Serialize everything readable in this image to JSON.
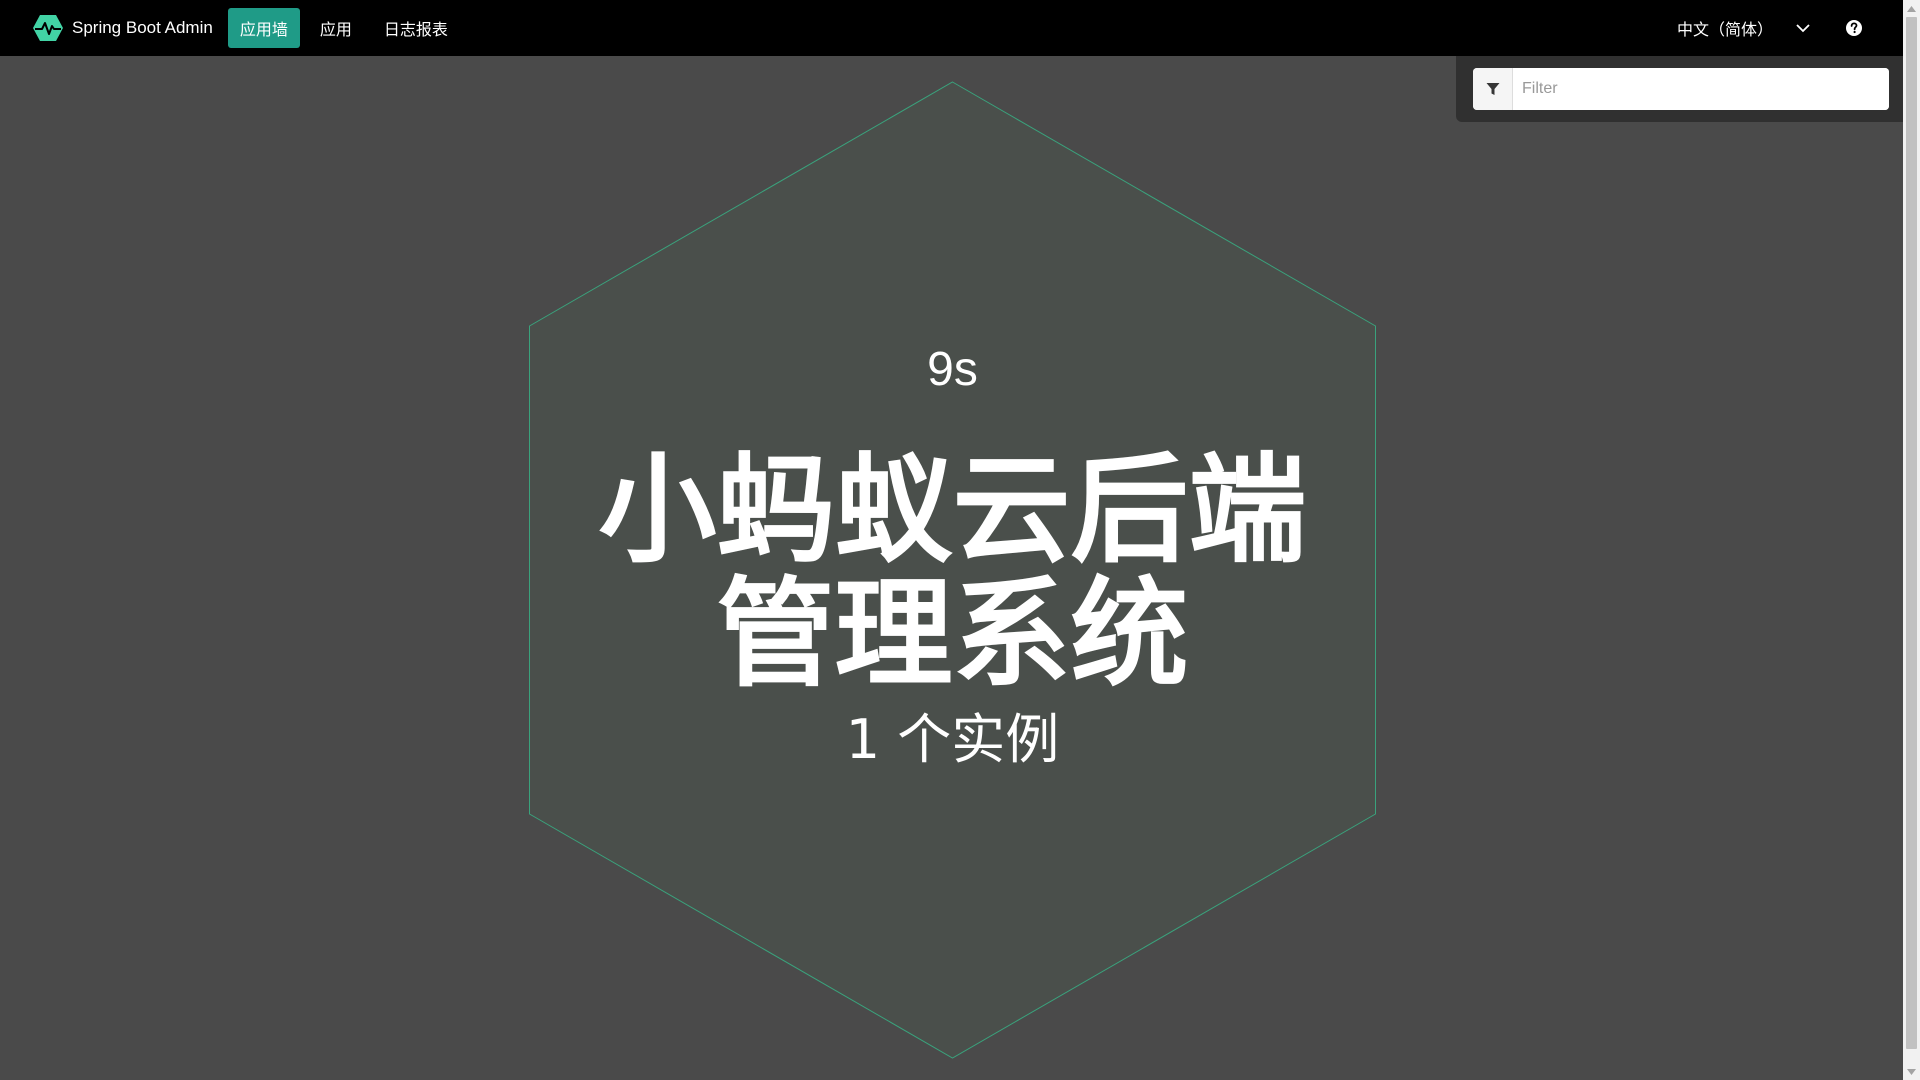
{
  "navbar": {
    "brand": "Spring Boot Admin",
    "items": [
      {
        "label": "应用墙",
        "active": true
      },
      {
        "label": "应用",
        "active": false
      },
      {
        "label": "日志报表",
        "active": false
      }
    ],
    "language": "中文（简体）",
    "icons": {
      "logo": "heartbeat-hexagon-logo",
      "language_toggle": "chevron-down-icon",
      "help": "question-circle-icon"
    }
  },
  "filter": {
    "placeholder": "Filter",
    "value": "",
    "icon": "filter-icon"
  },
  "applications": [
    {
      "uptime": "9s",
      "name": "小蚂蚁云后端管理系统",
      "instances": "1 个实例"
    }
  ],
  "colors": {
    "accent": "#1f9b87",
    "background": "#4a4a4a",
    "navbar": "#000000",
    "tile_fill": "#4a4f4b",
    "tile_stroke": "#3aa27c"
  }
}
